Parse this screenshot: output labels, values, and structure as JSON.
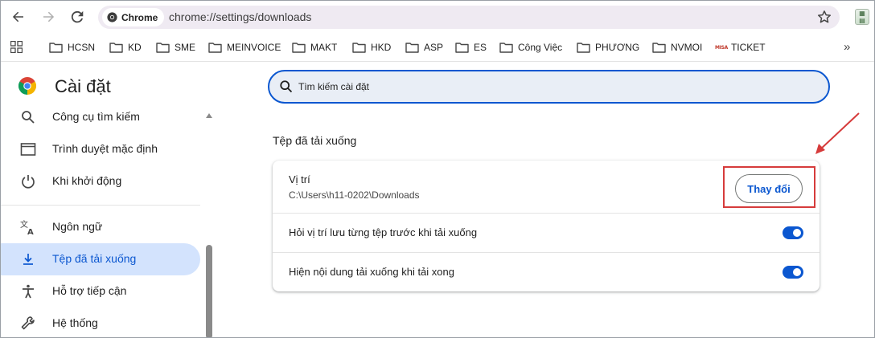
{
  "toolbar": {
    "chip_label": "Chrome",
    "url": "chrome://settings/downloads"
  },
  "bookmarks": [
    {
      "label": "HCSN",
      "icon": "folder-icon"
    },
    {
      "label": "KD",
      "icon": "folder-icon"
    },
    {
      "label": "SME",
      "icon": "folder-icon"
    },
    {
      "label": "MEINVOICE",
      "icon": "folder-icon"
    },
    {
      "label": "MAKT",
      "icon": "folder-icon"
    },
    {
      "label": "HKD",
      "icon": "folder-icon"
    },
    {
      "label": "ASP",
      "icon": "folder-icon"
    },
    {
      "label": "ES",
      "icon": "folder-icon"
    },
    {
      "label": "Công Việc",
      "icon": "folder-icon"
    },
    {
      "label": "PHƯƠNG",
      "icon": "folder-icon"
    },
    {
      "label": "NVMOI",
      "icon": "folder-icon"
    },
    {
      "label": "TICKET",
      "icon": "misa-logo-icon",
      "logo_text": "MISA"
    }
  ],
  "settings": {
    "title": "Cài đặt"
  },
  "sidebar": {
    "items": [
      {
        "label": "Công cụ tìm kiếm",
        "icon": "search-icon",
        "active": false
      },
      {
        "label": "Trình duyệt mặc định",
        "icon": "browser-window-icon",
        "active": false
      },
      {
        "label": "Khi khởi động",
        "icon": "power-icon",
        "active": false
      },
      {
        "label": "Ngôn ngữ",
        "icon": "translate-icon",
        "active": false
      },
      {
        "label": "Tệp đã tải xuống",
        "icon": "download-icon",
        "active": true
      },
      {
        "label": "Hỗ trợ tiếp cận",
        "icon": "accessibility-icon",
        "active": false
      },
      {
        "label": "Hệ thống",
        "icon": "wrench-icon",
        "active": false
      }
    ]
  },
  "search": {
    "placeholder": "Tìm kiếm cài đặt"
  },
  "downloads": {
    "section_title": "Tệp đã tải xuống",
    "location_label": "Vị trí",
    "location_path": "C:\\Users\\h11-0202\\Downloads",
    "change_button": "Thay đổi",
    "ask_label": "Hỏi vị trí lưu từng tệp trước khi tải xuống",
    "ask_enabled": true,
    "show_label": "Hiện nội dung tải xuống khi tải xong",
    "show_enabled": true
  },
  "colors": {
    "accent": "#0b57d0",
    "active_nav_bg": "#d3e3fd",
    "annotation_red": "#d63b3b"
  }
}
